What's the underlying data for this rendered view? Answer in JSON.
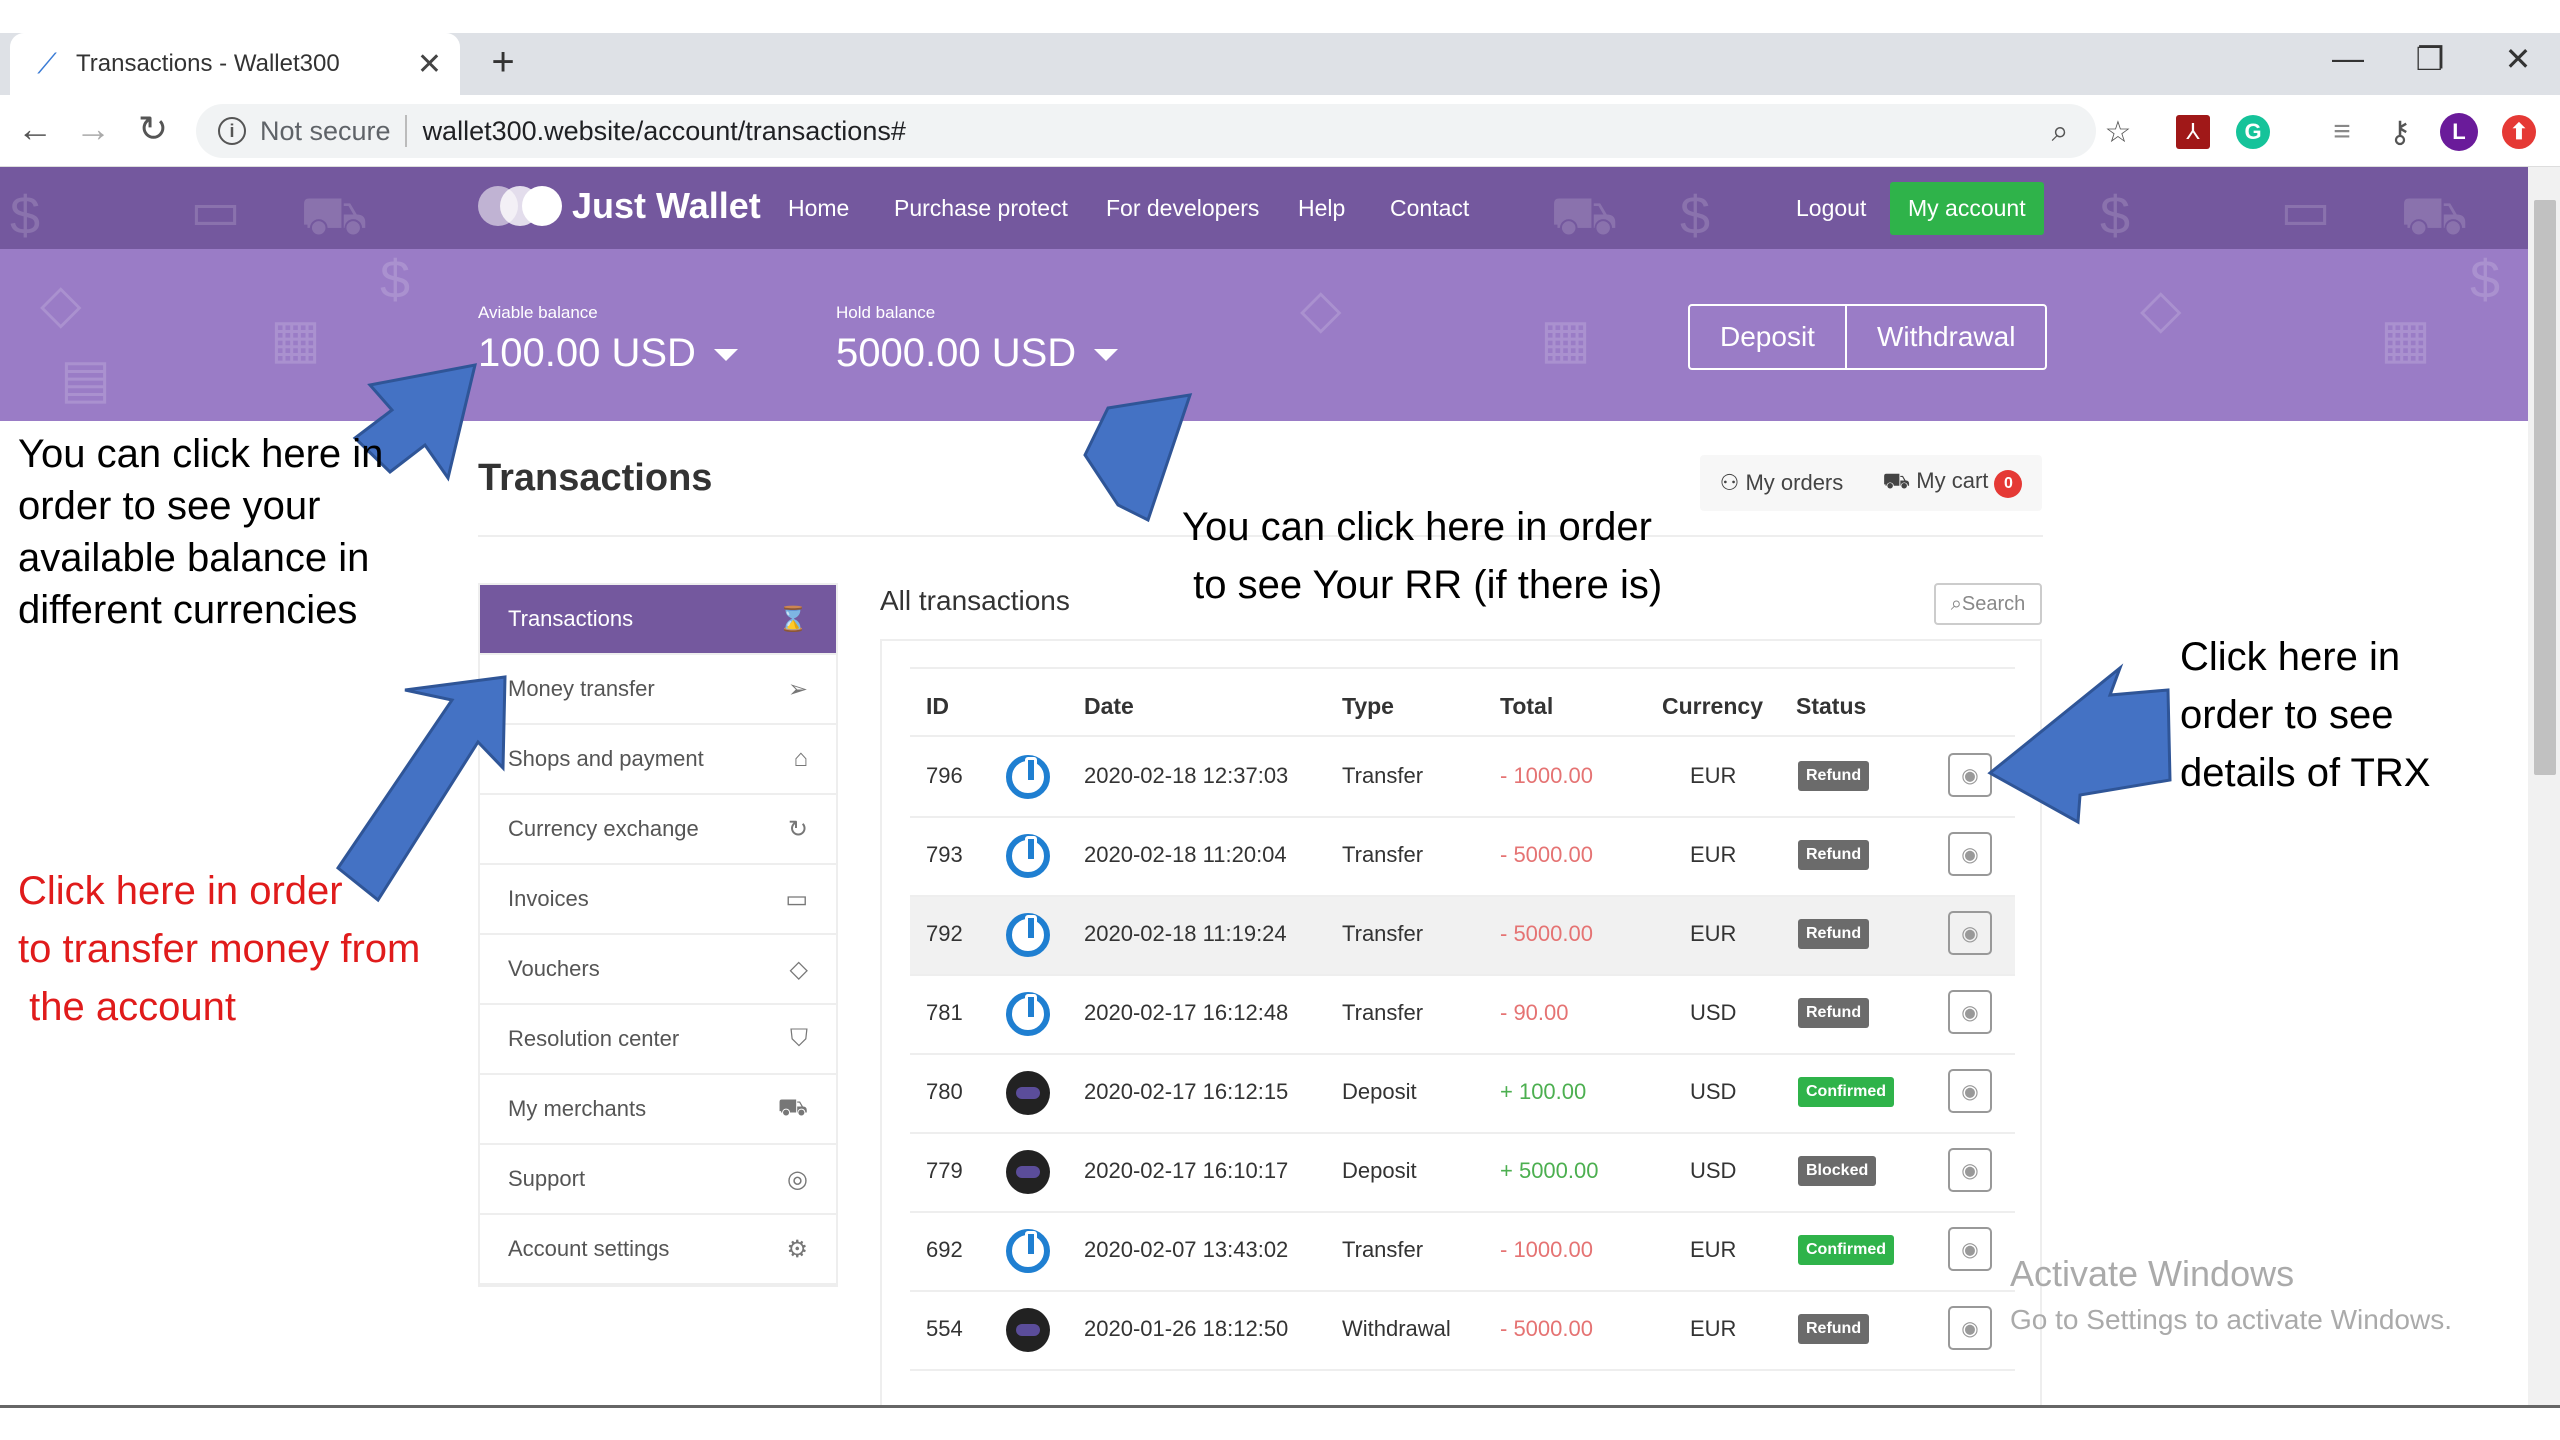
{
  "browser": {
    "tab_title": "Transactions - Wallet300",
    "not_secure": "Not secure",
    "url": "wallet300.website/account/transactions#",
    "profile_letter": "L"
  },
  "site": {
    "logo_text": "Just Wallet",
    "menu": [
      "Home",
      "Purchase protect",
      "For developers",
      "Help",
      "Contact"
    ],
    "logout": "Logout",
    "my_account": "My account"
  },
  "balances": {
    "available_label": "Aviable balance",
    "available_value": "100.00 USD",
    "hold_label": "Hold balance",
    "hold_value": "5000.00 USD",
    "deposit": "Deposit",
    "withdrawal": "Withdrawal"
  },
  "main": {
    "title": "Transactions",
    "my_orders": "My orders",
    "my_cart": "My cart",
    "cart_count": "0",
    "all_transactions": "All transactions",
    "search": "Search"
  },
  "sidebar": [
    {
      "label": "Transactions",
      "icon": "hourglass-icon",
      "glyph": "⌛"
    },
    {
      "label": "Money transfer",
      "icon": "send-icon",
      "glyph": "➢"
    },
    {
      "label": "Shops and payment",
      "icon": "bag-icon",
      "glyph": "⌂"
    },
    {
      "label": "Currency exchange",
      "icon": "refresh-icon",
      "glyph": "↻"
    },
    {
      "label": "Invoices",
      "icon": "card-icon",
      "glyph": "▭"
    },
    {
      "label": "Vouchers",
      "icon": "diamond-icon",
      "glyph": "◇"
    },
    {
      "label": "Resolution center",
      "icon": "shield-icon",
      "glyph": "⛉"
    },
    {
      "label": "My merchants",
      "icon": "cart-icon",
      "glyph": "⛟"
    },
    {
      "label": "Support",
      "icon": "lifebuoy-icon",
      "glyph": "◎"
    },
    {
      "label": "Account settings",
      "icon": "gear-icon",
      "glyph": "⚙"
    }
  ],
  "table": {
    "headers": [
      "ID",
      "Date",
      "Type",
      "Total",
      "Currency",
      "Status"
    ],
    "rows": [
      {
        "id": "796",
        "logo": "pw",
        "date": "2020-02-18 12:37:03",
        "type": "Transfer",
        "total": "- 1000.00",
        "sign": "neg",
        "currency": "EUR",
        "status": "Refund"
      },
      {
        "id": "793",
        "logo": "pw",
        "date": "2020-02-18 11:20:04",
        "type": "Transfer",
        "total": "- 5000.00",
        "sign": "neg",
        "currency": "EUR",
        "status": "Refund"
      },
      {
        "id": "792",
        "logo": "pw",
        "date": "2020-02-18 11:19:24",
        "type": "Transfer",
        "total": "- 5000.00",
        "sign": "neg",
        "currency": "EUR",
        "status": "Refund"
      },
      {
        "id": "781",
        "logo": "pw",
        "date": "2020-02-17 16:12:48",
        "type": "Transfer",
        "total": "- 90.00",
        "sign": "neg",
        "currency": "USD",
        "status": "Refund"
      },
      {
        "id": "780",
        "logo": "dk",
        "date": "2020-02-17 16:12:15",
        "type": "Deposit",
        "total": "+ 100.00",
        "sign": "pos",
        "currency": "USD",
        "status": "Confirmed"
      },
      {
        "id": "779",
        "logo": "dk",
        "date": "2020-02-17 16:10:17",
        "type": "Deposit",
        "total": "+ 5000.00",
        "sign": "pos",
        "currency": "USD",
        "status": "Blocked"
      },
      {
        "id": "692",
        "logo": "pw",
        "date": "2020-02-07 13:43:02",
        "type": "Transfer",
        "total": "- 1000.00",
        "sign": "neg",
        "currency": "EUR",
        "status": "Confirmed"
      },
      {
        "id": "554",
        "logo": "dk",
        "date": "2020-01-26 18:12:50",
        "type": "Withdrawal",
        "total": "- 5000.00",
        "sign": "neg",
        "currency": "EUR",
        "status": "Refund"
      }
    ]
  },
  "annotations": {
    "balance": [
      "You can click here in",
      "order to see your",
      "available balance in",
      "different currencies"
    ],
    "rr": [
      "You can click here in order",
      " to see Your RR (if there is)"
    ],
    "transfer": [
      "Click here in order",
      "to transfer money from",
      " the account"
    ],
    "details": [
      "Click here in",
      "order to see",
      "details of TRX"
    ]
  },
  "windows": {
    "line1": "Activate Windows",
    "line2": "Go to Settings to activate Windows."
  },
  "colors": {
    "nav": "#74589e",
    "hero": "#9a7cc6",
    "accent_green": "#2fb34a",
    "arrow_blue": "#4472c4",
    "red_text": "#e01b1b"
  }
}
